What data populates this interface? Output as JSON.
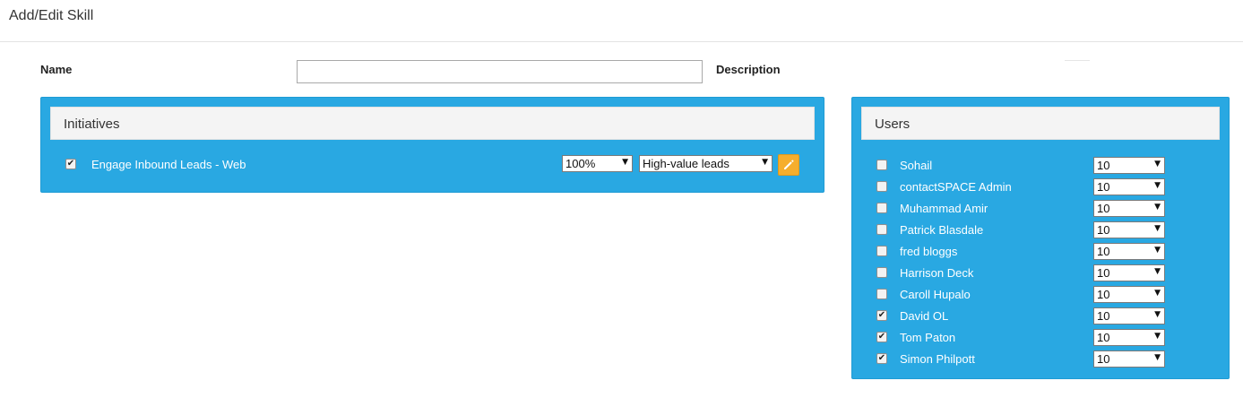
{
  "page": {
    "title": "Add/Edit Skill"
  },
  "form": {
    "name_label": "Name",
    "name_value": "",
    "description_label": "Description"
  },
  "initiatives": {
    "title": "Initiatives",
    "items": [
      {
        "label": "Engage Inbound Leads - Web",
        "checked": true,
        "percent": "100%",
        "category": "High-value leads",
        "edit_icon": "pencil-icon"
      }
    ]
  },
  "users": {
    "title": "Users",
    "items": [
      {
        "name": "Sohail",
        "checked": false,
        "level": "10"
      },
      {
        "name": "contactSPACE Admin",
        "checked": false,
        "level": "10"
      },
      {
        "name": "Muhammad Amir",
        "checked": false,
        "level": "10"
      },
      {
        "name": "Patrick Blasdale",
        "checked": false,
        "level": "10"
      },
      {
        "name": "fred bloggs",
        "checked": false,
        "level": "10"
      },
      {
        "name": "Harrison Deck",
        "checked": false,
        "level": "10"
      },
      {
        "name": "Caroll Hupalo",
        "checked": false,
        "level": "10"
      },
      {
        "name": "David OL",
        "checked": true,
        "level": "10"
      },
      {
        "name": "Tom Paton",
        "checked": true,
        "level": "10"
      },
      {
        "name": "Simon Philpott",
        "checked": true,
        "level": "10"
      }
    ]
  },
  "colors": {
    "panel": "#29a8e2",
    "panel_head": "#f4f4f4",
    "edit_button": "#f6ae2d"
  }
}
